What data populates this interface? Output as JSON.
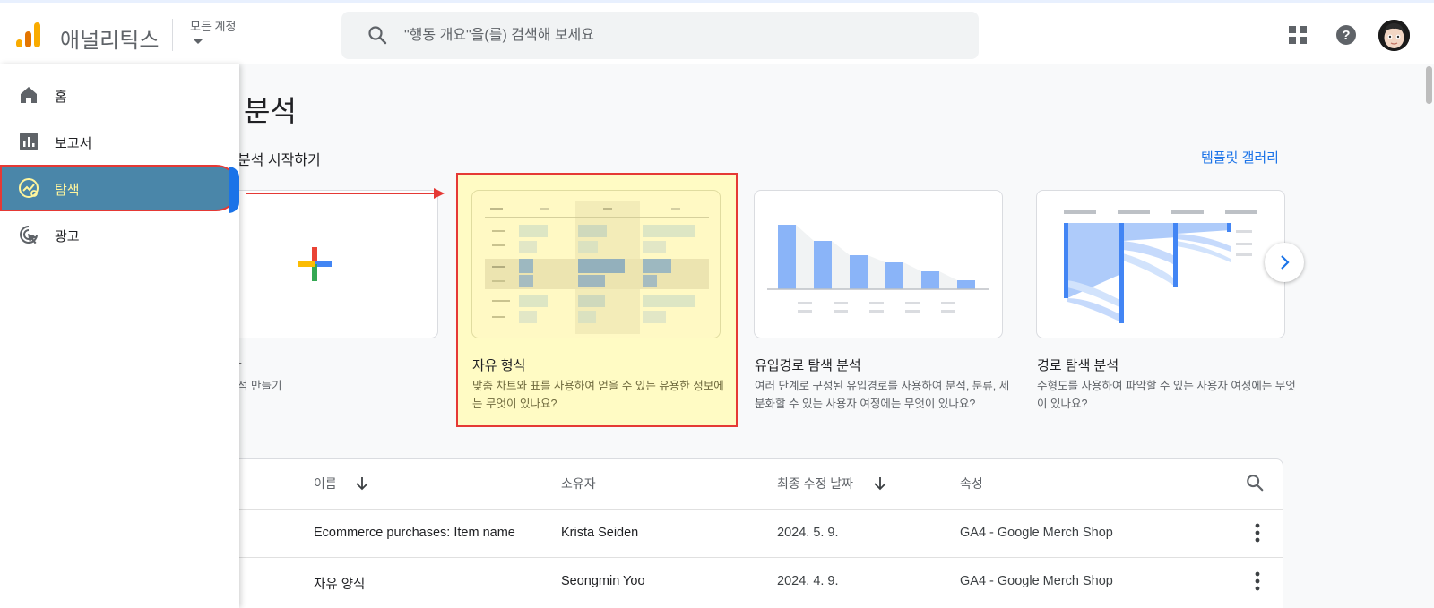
{
  "header": {
    "brand": "애널리틱스",
    "account_label": "모든 계정",
    "search_placeholder": "\"행동 개요\"을(를) 검색해 보세요"
  },
  "sidebar": {
    "items": [
      {
        "label": "홈",
        "icon": "home-icon"
      },
      {
        "label": "보고서",
        "icon": "bar-chart-icon"
      },
      {
        "label": "탐색",
        "icon": "explore-icon",
        "active": true
      },
      {
        "label": "광고",
        "icon": "ads-cursor-icon"
      }
    ]
  },
  "main": {
    "title": "분석",
    "section_title": "분석 시작하기",
    "gallery_link": "템플릿 갤러리",
    "cards": [
      {
        "title": "-",
        "desc": "석 만들기"
      },
      {
        "title": "자유 형식",
        "desc": "맞춤 차트와 표를 사용하여 얻을 수 있는 유용한 정보에는 무엇이 있나요?"
      },
      {
        "title": "유입경로 탐색 분석",
        "desc": "여러 단계로 구성된 유입경로를 사용하여 분석, 분류, 세분화할 수 있는 사용자 여정에는 무엇이 있나요?"
      },
      {
        "title": "경로 탐색 분석",
        "desc": "수형도를 사용하여 파악할 수 있는 사용자 여정에는 무엇이 있나요?"
      }
    ]
  },
  "table": {
    "headers": {
      "name": "이름",
      "owner": "소유자",
      "modified": "최종 수정 날짜",
      "property": "속성"
    },
    "rows": [
      {
        "name": "Ecommerce purchases: Item name",
        "owner": "Krista Seiden",
        "modified": "2024. 5. 9.",
        "property": "GA4 - Google Merch Shop"
      },
      {
        "name": "자유 양식",
        "owner": "Seongmin Yoo",
        "modified": "2024. 4. 9.",
        "property": "GA4 - Google Merch Shop"
      }
    ]
  },
  "colors": {
    "accent": "#1a73e8",
    "highlight": "#fff9c4",
    "annotation": "#e53935",
    "active_nav": "#4a86a9"
  }
}
